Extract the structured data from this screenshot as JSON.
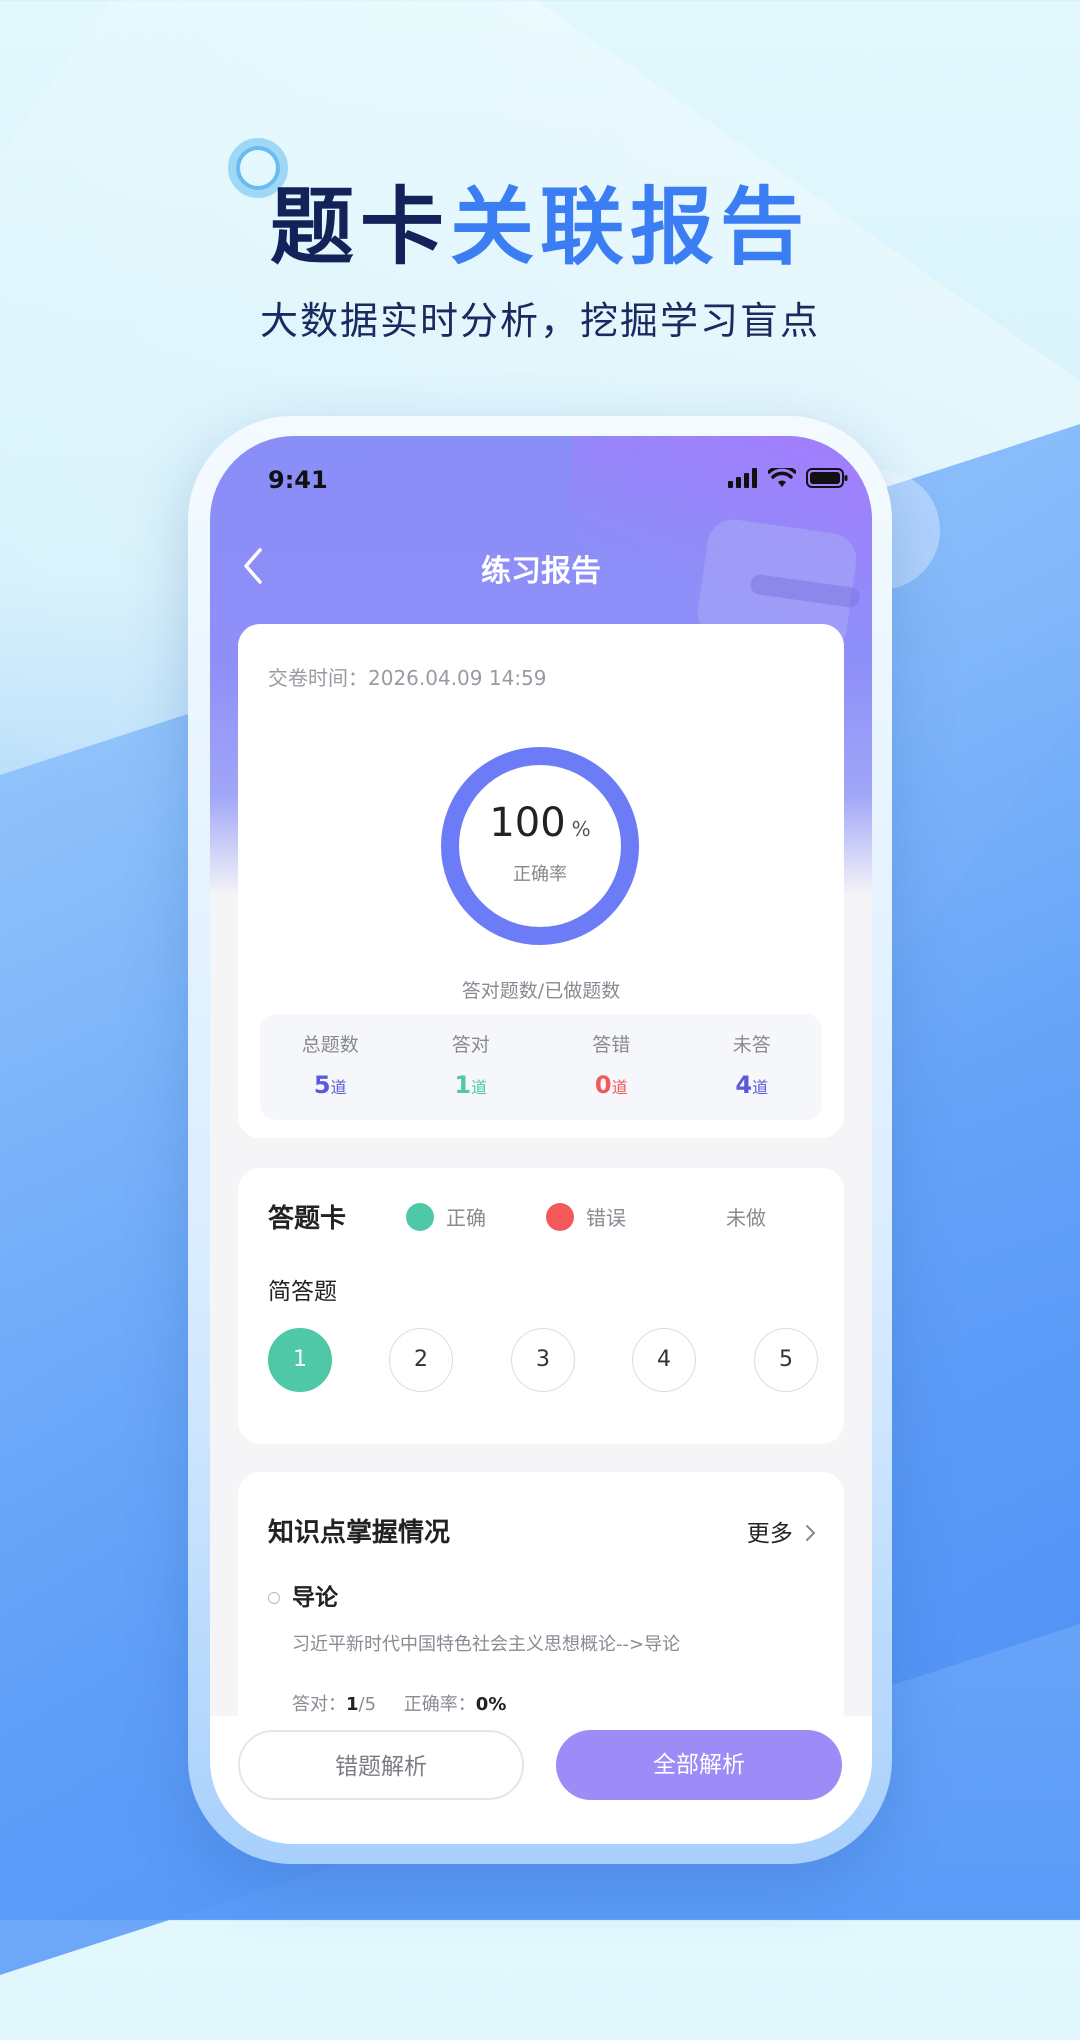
{
  "promo": {
    "title_dark": "题卡",
    "title_blue": "关联报告",
    "subtitle": "大数据实时分析，挖掘学习盲点"
  },
  "status_bar": {
    "time": "9:41"
  },
  "nav": {
    "title": "练习报告"
  },
  "report": {
    "submit_time": "交卷时间：2026.04.09 14:59",
    "accuracy_value": "100",
    "accuracy_unit": "%",
    "accuracy_fraction": 1.0,
    "accuracy_label": "正确率",
    "caption": "答对题数/已做题数",
    "stats": [
      {
        "label": "总题数",
        "value": "5",
        "unit": "道",
        "color": "#5a5ad8"
      },
      {
        "label": "答对",
        "value": "1",
        "unit": "道",
        "color": "#4ec8a6"
      },
      {
        "label": "答错",
        "value": "0",
        "unit": "道",
        "color": "#f25a5a"
      },
      {
        "label": "未答",
        "value": "4",
        "unit": "道",
        "color": "#5a5ad8"
      }
    ]
  },
  "answer_card": {
    "title": "答题卡",
    "legend_correct": "正确",
    "legend_wrong": "错误",
    "legend_undone": "未做",
    "color_correct": "#4ec8a6",
    "color_wrong": "#f25a5a",
    "question_type": "简答题",
    "questions": [
      {
        "num": "1",
        "state": "correct"
      },
      {
        "num": "2",
        "state": "undone"
      },
      {
        "num": "3",
        "state": "undone"
      },
      {
        "num": "4",
        "state": "undone"
      },
      {
        "num": "5",
        "state": "undone"
      }
    ]
  },
  "knowledge": {
    "title": "知识点掌握情况",
    "more": "更多",
    "item_name": "导论",
    "item_path": "习近平新时代中国特色社会主义思想概论-->导论",
    "correct_label": "答对：",
    "correct_value": "1",
    "total_value": "/5",
    "rate_label": "正确率：",
    "rate_value": "0%"
  },
  "buttons": {
    "wrong_analysis": "错题解析",
    "all_analysis": "全部解析"
  }
}
